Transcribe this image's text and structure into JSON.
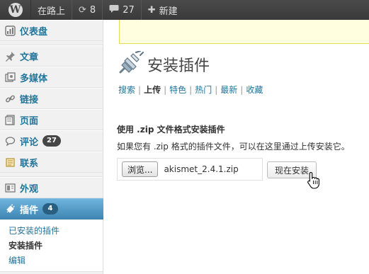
{
  "adminbar": {
    "site_name": "在路上",
    "updates_count": "8",
    "comments_count": "27",
    "new_label": "新建"
  },
  "sidebar": {
    "items": [
      {
        "label": "仪表盘",
        "icon": "dashboard-icon"
      },
      {
        "label": "文章",
        "icon": "pin-icon"
      },
      {
        "label": "多媒体",
        "icon": "media-icon"
      },
      {
        "label": "链接",
        "icon": "link-icon"
      },
      {
        "label": "页面",
        "icon": "page-icon"
      },
      {
        "label": "评论",
        "icon": "comment-icon",
        "badge": "27"
      },
      {
        "label": "联系",
        "icon": "contact-icon"
      },
      {
        "label": "外观",
        "icon": "appearance-icon"
      },
      {
        "label": "插件",
        "icon": "plugin-icon",
        "badge": "4"
      }
    ],
    "submenu": [
      {
        "label": "已安装的插件"
      },
      {
        "label": "安装插件"
      },
      {
        "label": "编辑"
      }
    ]
  },
  "main": {
    "title": "安装插件",
    "tabs": [
      "搜索",
      "上传",
      "特色",
      "热门",
      "最新",
      "收藏"
    ],
    "upload": {
      "heading": "使用 .zip 文件格式安装插件",
      "description": "如果您有 .zip 格式的插件文件，可以在这里通过上传安装它。",
      "browse_label": "浏览...",
      "file_name": "akismet_2.4.1.zip",
      "install_label": "现在安装"
    }
  },
  "colors": {
    "adminbar": "#464646",
    "link": "#21759b",
    "active_menu": "#4f94c0",
    "notice_bg": "#ffffe0"
  }
}
